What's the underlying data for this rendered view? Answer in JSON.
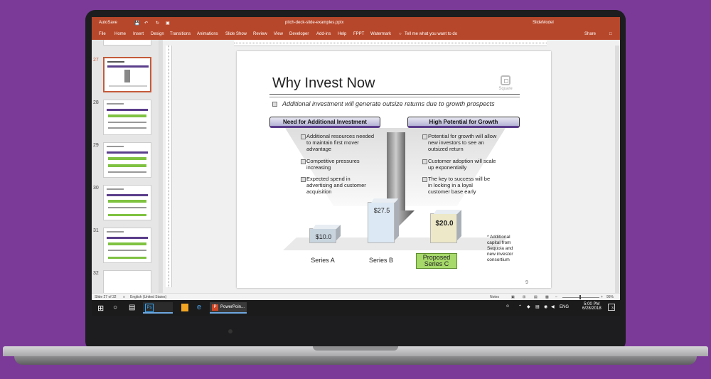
{
  "window": {
    "autosave": "AutoSave",
    "filename": "pitch-deck-slide-examples.pptx",
    "brand": "SlideModel"
  },
  "ribbon": {
    "tabs": [
      "File",
      "Home",
      "Insert",
      "Design",
      "Transitions",
      "Animations",
      "Slide Show",
      "Review",
      "View",
      "Developer",
      "Add-ins",
      "Help",
      "FPPT",
      "Watermark"
    ],
    "tell_me": "Tell me what you want to do",
    "share": "Share"
  },
  "thumbnails": [
    {
      "num": "27",
      "selected": true
    },
    {
      "num": "28",
      "selected": false
    },
    {
      "num": "29",
      "selected": false
    },
    {
      "num": "30",
      "selected": false
    },
    {
      "num": "31",
      "selected": false
    },
    {
      "num": "32",
      "selected": false
    }
  ],
  "slide": {
    "title": "Why Invest Now",
    "logo_text": "Square",
    "subtitle": "Additional investment will generate outsize returns due to growth prospects",
    "left_header": "Need for Additional Investment",
    "right_header": "High Potential for Growth",
    "left_points": [
      "Additional resources needed to maintain first mover advantage",
      "Competitive pressures increasing",
      "Expected spend in advertising and customer acquisition"
    ],
    "right_points": [
      "Potential for growth will allow new investors to see an outsized return",
      "Customer adoption will scale up exponentially",
      "The key to success will be in locking in a loyal customer base early"
    ],
    "footnote": "* Additional capital from Sequoia and new investor consortium",
    "page_number": "9"
  },
  "chart_data": {
    "type": "bar",
    "categories": [
      "Series A",
      "Series B",
      "Proposed Series C"
    ],
    "values": [
      10.0,
      27.5,
      20.0
    ],
    "labels": [
      "$10.0",
      "$27.5",
      "$20.0"
    ],
    "colors": [
      "#c8d4de",
      "#dce8f3",
      "#ece8c8"
    ]
  },
  "status": {
    "slide_info": "Slide 27 of 32",
    "language": "English (United States)",
    "notes": "Notes",
    "zoom": "95%"
  },
  "taskbar": {
    "app_label": "PowerPoin...",
    "lang": "ENG",
    "time": "5:00 PM",
    "date": "6/28/2018",
    "notif_count": "3"
  }
}
